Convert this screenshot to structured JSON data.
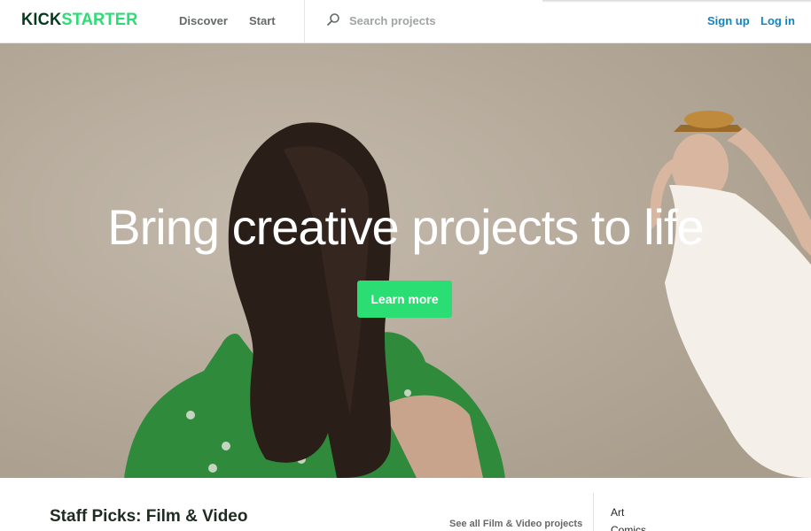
{
  "header": {
    "logo": {
      "part1": "KICK",
      "part2": "STARTER"
    },
    "nav": {
      "discover": "Discover",
      "start": "Start"
    },
    "search": {
      "placeholder": "Search projects",
      "icon": "search-icon"
    },
    "auth": {
      "signup": "Sign up",
      "login": "Log in"
    }
  },
  "hero": {
    "title": "Bring creative projects to life",
    "cta_label": "Learn more"
  },
  "staff_picks": {
    "title": "Staff Picks: Film & Video",
    "see_all": "See all Film & Video projects"
  },
  "categories": [
    {
      "label": "Art"
    },
    {
      "label": "Comics"
    }
  ],
  "colors": {
    "brand_green": "#2bde73",
    "brand_dark": "#06391f",
    "link_blue": "#0e85c4",
    "nav_gray": "#656969"
  }
}
